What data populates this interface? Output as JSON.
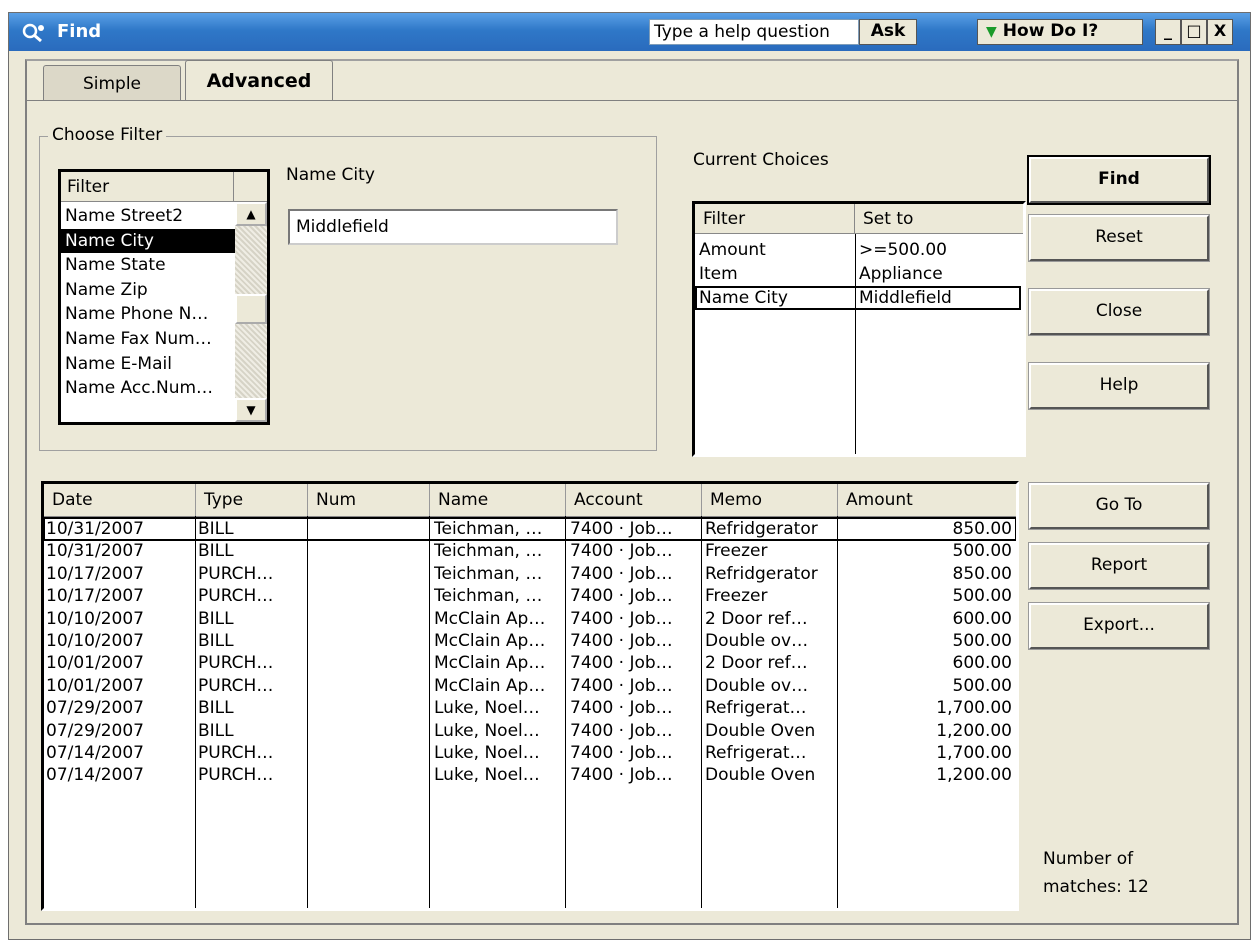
{
  "window": {
    "title": "Find",
    "help_placeholder": "Type a help question",
    "ask_label": "Ask",
    "howdo_label": "How Do I?",
    "min_label": "_",
    "max_label": "□",
    "close_label": "X"
  },
  "tabs": {
    "simple": "Simple",
    "advanced": "Advanced"
  },
  "choose_filter": {
    "legend": "Choose Filter",
    "list_header": "Filter",
    "items": [
      "Name Street2",
      "Name City",
      "Name State",
      "Name Zip",
      "Name Phone N…",
      "Name Fax Num…",
      "Name E-Mail",
      "Name Acc.Num…"
    ],
    "selected": "Name City",
    "field_label": "Name City",
    "field_value": "Middlefield"
  },
  "current_choices": {
    "label": "Current Choices",
    "headers": [
      "Filter",
      "Set to"
    ],
    "rows": [
      {
        "filter": "Amount",
        "value": ">=500.00"
      },
      {
        "filter": "Item",
        "value": "Appliance"
      },
      {
        "filter": "Name City",
        "value": "Middlefield"
      }
    ]
  },
  "buttons": {
    "find": "Find",
    "reset": "Reset",
    "close": "Close",
    "help": "Help",
    "goto": "Go To",
    "report": "Report",
    "export": "Export..."
  },
  "results": {
    "headers": [
      "Date",
      "Type",
      "Num",
      "Name",
      "Account",
      "Memo",
      "Amount"
    ],
    "rows": [
      [
        "10/31/2007",
        "BILL",
        "",
        "Teichman, …",
        "7400 · Job…",
        "Refridgerator",
        "850.00"
      ],
      [
        "10/31/2007",
        "BILL",
        "",
        "Teichman, …",
        "7400 · Job…",
        "Freezer",
        "500.00"
      ],
      [
        "10/17/2007",
        "PURCH…",
        "",
        "Teichman, …",
        "7400 · Job…",
        "Refridgerator",
        "850.00"
      ],
      [
        "10/17/2007",
        "PURCH…",
        "",
        "Teichman, …",
        "7400 · Job…",
        "Freezer",
        "500.00"
      ],
      [
        "10/10/2007",
        "BILL",
        "",
        "McClain Ap…",
        "7400 · Job…",
        "2 Door  ref…",
        "600.00"
      ],
      [
        "10/10/2007",
        "BILL",
        "",
        "McClain Ap…",
        "7400 · Job…",
        "Double ov…",
        "500.00"
      ],
      [
        "10/01/2007",
        "PURCH…",
        "",
        "McClain Ap…",
        "7400 · Job…",
        "2 Door  ref…",
        "600.00"
      ],
      [
        "10/01/2007",
        "PURCH…",
        "",
        "McClain Ap…",
        "7400 · Job…",
        "Double ov…",
        "500.00"
      ],
      [
        "07/29/2007",
        "BILL",
        "",
        "Luke, Noel…",
        "7400 · Job…",
        "Refrigerat…",
        "1,700.00"
      ],
      [
        "07/29/2007",
        "BILL",
        "",
        "Luke, Noel…",
        "7400 · Job…",
        "Double Oven",
        "1,200.00"
      ],
      [
        "07/14/2007",
        "PURCH…",
        "",
        "Luke, Noel…",
        "7400 · Job…",
        "Refrigerat…",
        "1,700.00"
      ],
      [
        "07/14/2007",
        "PURCH…",
        "",
        "Luke, Noel…",
        "7400 · Job…",
        "Double Oven",
        "1,200.00"
      ]
    ]
  },
  "matches": {
    "line1": "Number of",
    "line2": "matches: 12"
  }
}
